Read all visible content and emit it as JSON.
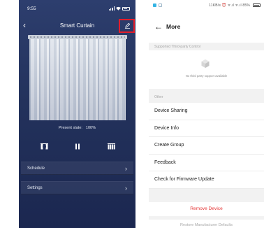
{
  "left_screen": {
    "status_time": "9:55",
    "title": "Smart Curtain",
    "back_icon": "chevron-left-icon",
    "edit_icon": "pencil-edit-icon",
    "highlight_color": "#e21d2b",
    "present_state_label": "Present state:",
    "present_state_value": "100%",
    "controls": [
      {
        "name": "open-curtain",
        "icon": "curtain-open-icon"
      },
      {
        "name": "pause-curtain",
        "icon": "pause-icon"
      },
      {
        "name": "close-curtain",
        "icon": "curtain-closed-icon"
      }
    ],
    "rows": [
      {
        "label": "Schedule",
        "chevron": "›"
      },
      {
        "label": "Settings",
        "chevron": "›"
      }
    ]
  },
  "right_screen": {
    "status_text": "11KB/s ⏰ ᯤ.ıl ᯤ.ıl 85%",
    "back_glyph": "←",
    "title": "More",
    "third_party_section": "Supported Third-party Control",
    "third_party_empty": "No third party support available",
    "other_section": "Other",
    "items": [
      "Device Sharing",
      "Device Info",
      "Create Group",
      "Feedback",
      "Check for Firmware Update"
    ],
    "remove_label": "Remove Device",
    "remove_color": "#e63535",
    "restore_label": "Restore Manufacturer Defaults"
  }
}
